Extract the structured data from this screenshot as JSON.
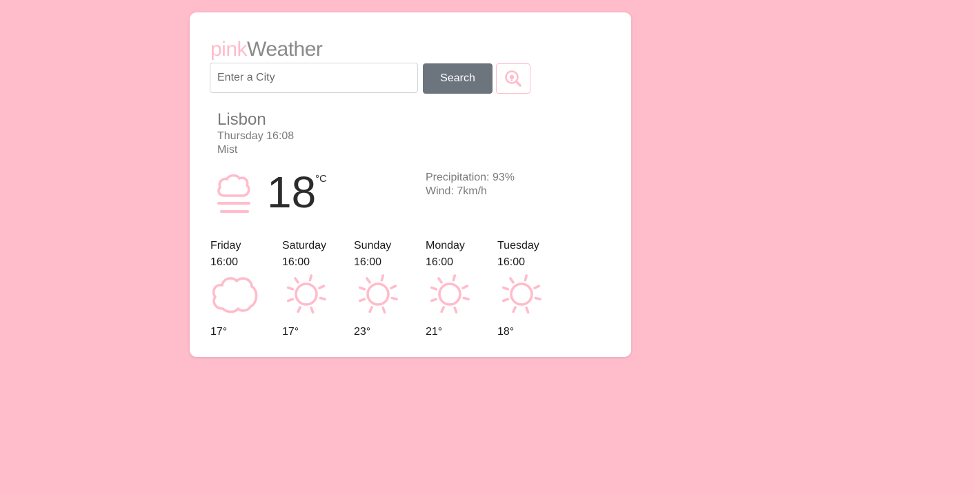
{
  "app": {
    "logo_part1": "pink",
    "logo_part2": "Weather",
    "accent_color": "#ffbccb",
    "background_color": "#ffbccb"
  },
  "search": {
    "placeholder": "Enter a City",
    "value": "",
    "button_label": "Search",
    "locate_icon": "location-search-icon"
  },
  "current": {
    "city": "Lisbon",
    "datetime": "Thursday 16:08",
    "description": "Mist",
    "icon": "mist-icon",
    "temperature": "18",
    "unit": "°C",
    "precipitation": "Precipitation: 93%",
    "wind": "Wind: 7km/h"
  },
  "forecast": [
    {
      "day": "Friday",
      "time": "16:00",
      "icon": "cloud-icon",
      "temp": "17°"
    },
    {
      "day": "Saturday",
      "time": "16:00",
      "icon": "sun-icon",
      "temp": "17°"
    },
    {
      "day": "Sunday",
      "time": "16:00",
      "icon": "sun-icon",
      "temp": "23°"
    },
    {
      "day": "Monday",
      "time": "16:00",
      "icon": "sun-icon",
      "temp": "21°"
    },
    {
      "day": "Tuesday",
      "time": "16:00",
      "icon": "sun-icon",
      "temp": "18°"
    }
  ]
}
